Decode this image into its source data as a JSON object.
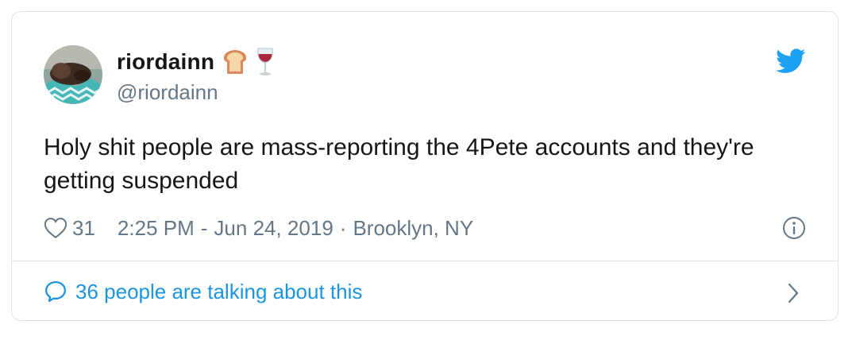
{
  "user": {
    "display_name": "riordainn",
    "handle": "@riordainn",
    "name_emojis": [
      "bread-emoji",
      "wine-glass-emoji"
    ]
  },
  "tweet": {
    "text": "Holy shit people are mass-reporting the 4Pete accounts and they're getting suspended",
    "like_count": "31",
    "time": "2:25 PM",
    "date": "Jun 24, 2019",
    "location": "Brooklyn, NY"
  },
  "footer": {
    "talking_text": "36 people are talking about this"
  },
  "icons": {
    "brand": "twitter-bird-icon",
    "like": "heart-icon",
    "info": "info-icon",
    "reply": "speech-bubble-icon",
    "more": "chevron-right-icon"
  },
  "colors": {
    "brand_blue": "#1da1f2",
    "link_blue": "#1b95e0",
    "text_primary": "#14171a",
    "text_secondary": "#657786",
    "border": "#dfe3e6"
  }
}
